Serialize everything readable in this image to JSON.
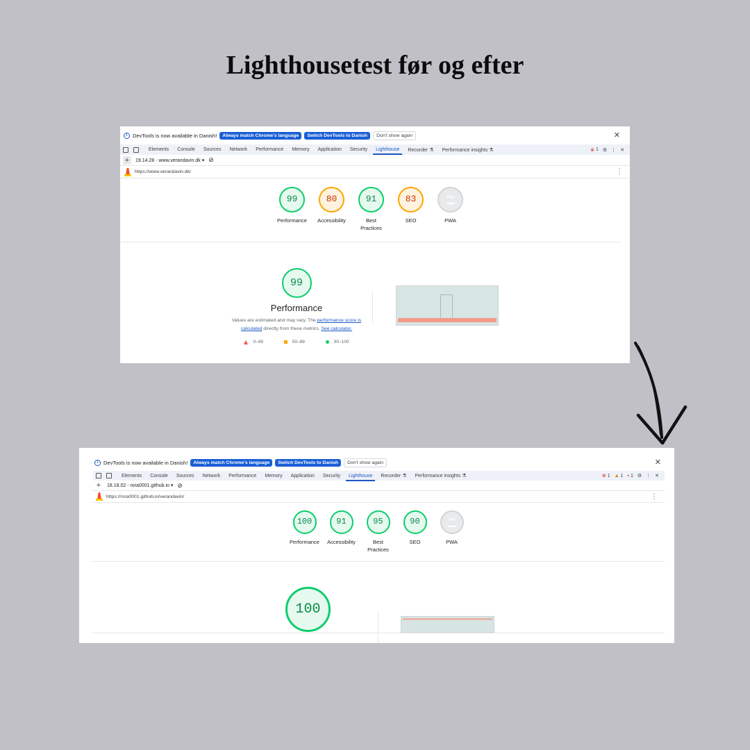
{
  "title": "Lighthousetest før og efter",
  "before": {
    "banner": {
      "text": "DevTools is now available in Danish!",
      "match_button": "Always match Chrome's language",
      "switch_button": "Switch DevTools to Danish",
      "dismiss_button": "Don't show again"
    },
    "tabs": [
      "Elements",
      "Console",
      "Sources",
      "Network",
      "Performance",
      "Memory",
      "Application",
      "Security",
      "Lighthouse",
      "Recorder ⚗",
      "Performance insights ⚗"
    ],
    "active_tab": "Lighthouse",
    "error_count": "1",
    "run_label": "19.14.28 - www.verandavin.dk ▾",
    "url": "https://www.verandavin.dk/",
    "gauges": [
      {
        "score": "99",
        "label": "Performance",
        "status": "green"
      },
      {
        "score": "80",
        "label": "Accessibility",
        "status": "orange"
      },
      {
        "score": "91",
        "label": "Best Practices",
        "status": "green"
      },
      {
        "score": "83",
        "label": "SEO",
        "status": "orange"
      },
      {
        "score": "PWA",
        "label": "PWA",
        "status": "grey"
      }
    ],
    "performance": {
      "score": "99",
      "title": "Performance",
      "desc_1": "Values are estimated and may vary. The ",
      "desc_link_1": "performance score is calculated",
      "desc_2": " directly from these metrics. ",
      "desc_link_2": "See calculator.",
      "legend": [
        "0–49",
        "50–89",
        "90–100"
      ]
    }
  },
  "after": {
    "banner": {
      "text": "DevTools is now available in Danish!",
      "match_button": "Always match Chrome's language",
      "switch_button": "Switch DevTools to Danish",
      "dismiss_button": "Don't show again"
    },
    "tabs": [
      "Elements",
      "Console",
      "Sources",
      "Network",
      "Performance",
      "Memory",
      "Application",
      "Security",
      "Lighthouse",
      "Recorder ⚗",
      "Performance insights ⚗"
    ],
    "active_tab": "Lighthouse",
    "error_count": "1",
    "warning_count": "1",
    "issue_count": "1",
    "run_label": "18.18.02 - rora0001.github.io ▾",
    "url": "https://rora0001.github.io/verandavin/",
    "gauges": [
      {
        "score": "100",
        "label": "Performance",
        "status": "green"
      },
      {
        "score": "91",
        "label": "Accessibility",
        "status": "green"
      },
      {
        "score": "95",
        "label": "Best Practices",
        "status": "green"
      },
      {
        "score": "90",
        "label": "SEO",
        "status": "green"
      },
      {
        "score": "PWA",
        "label": "PWA",
        "status": "grey"
      }
    ],
    "performance": {
      "score": "100"
    }
  },
  "colors": {
    "background": "#c2c0c7",
    "pass": "#0cce6b",
    "average": "#ffa400",
    "fail": "#ff4e42",
    "accent": "#1a56c4"
  }
}
